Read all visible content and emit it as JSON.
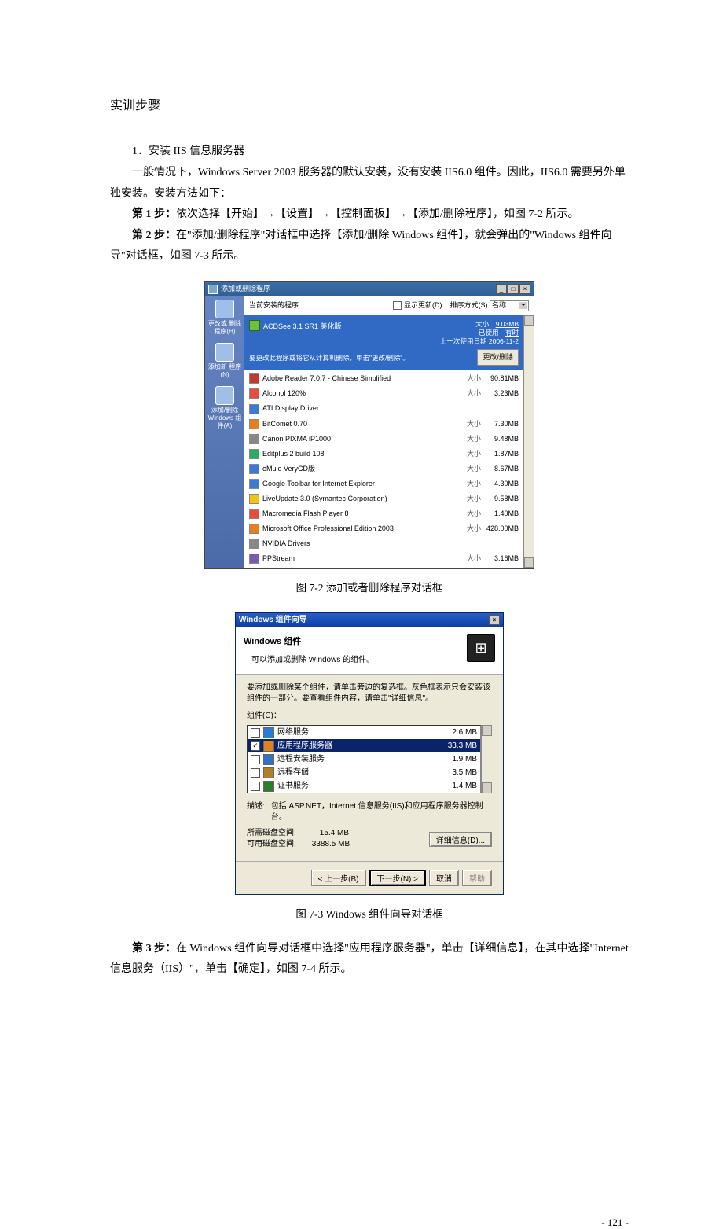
{
  "doc": {
    "heading": "实训步骤",
    "sub1_num": "1．",
    "sub1_title": "安装 IIS 信息服务器",
    "para1": "一般情况下，Windows Server 2003 服务器的默认安装，没有安装 IIS6.0 组件。因此，IIS6.0 需要另外单独安装。安装方法如下：",
    "step1_b": "第 1 步：",
    "step1_t": "依次选择【开始】→【设置】→【控制面板】→【添加/删除程序】，如图 7-2 所示。",
    "step2_b": "第 2 步：",
    "step2_t": "在\"添加/删除程序\"对话框中选择【添加/删除 Windows 组件】，就会弹出的\"Windows 组件向导\"对话框，如图 7-3 所示。",
    "cap1": "图 7-2   添加或者删除程序对话框",
    "cap2": "图 7-3   Windows 组件向导对话框",
    "step3_b": "第 3 步：",
    "step3_t": "在 Windows 组件向导对话框中选择\"应用程序服务器\"，单击【详细信息】，在其中选择\"Internet 信息服务（IIS）\"，单击【确定】，如图 7-4 所示。",
    "pagenum": "- 121 -"
  },
  "ar": {
    "title": "添加或删除程序",
    "side": [
      "更改或\n删除\n程序(H)",
      "添加新\n程序(N)",
      "添加/删除\nWindows\n组件(A)"
    ],
    "top_lbl": "当前安装的程序:",
    "top_show": "显示更新(D)",
    "top_sort": "排序方式(S):",
    "top_sort_val": "名称",
    "sel_name": "ACDSee 3.1 SR1 美化版",
    "sel_meta": [
      {
        "k": "大小",
        "v": "9.03MB"
      },
      {
        "k": "已使用",
        "v": "有时"
      },
      {
        "k": "上一次使用日期",
        "v": "2006-11-2"
      }
    ],
    "sel_info": "要更改此程序或将它从计算机删除，单击\"更改/删除\"。",
    "sel_btn": "更改/删除",
    "rows": [
      {
        "n": "Adobe Reader 7.0.7 - Chinese Simplified",
        "s": "90.81MB",
        "ic": "ry"
      },
      {
        "n": "Alcohol 120%",
        "s": "3.23MB",
        "ic": "rd"
      },
      {
        "n": "ATI Display Driver",
        "s": "",
        "ic": "bl"
      },
      {
        "n": "BitComet 0.70",
        "s": "7.30MB",
        "ic": "or"
      },
      {
        "n": "Canon PIXMA iP1000",
        "s": "9.48MB",
        "ic": "gr"
      },
      {
        "n": "Editplus 2 build 108",
        "s": "1.87MB",
        "ic": "gn"
      },
      {
        "n": "eMule VeryCD版",
        "s": "8.67MB",
        "ic": "bl"
      },
      {
        "n": "Google Toolbar for Internet Explorer",
        "s": "4.30MB",
        "ic": "bl"
      },
      {
        "n": "LiveUpdate 3.0 (Symantec Corporation)",
        "s": "9.58MB",
        "ic": "yl"
      },
      {
        "n": "Macromedia Flash Player 8",
        "s": "1.40MB",
        "ic": "rd"
      },
      {
        "n": "Microsoft Office Professional Edition 2003",
        "s": "428.00MB",
        "ic": "or"
      },
      {
        "n": "NVIDIA Drivers",
        "s": "",
        "ic": "gr"
      },
      {
        "n": "PPStream",
        "s": "3.16MB",
        "ic": "pu"
      }
    ],
    "row_lbl": "大小"
  },
  "wz": {
    "title": "Windows 组件向导",
    "hd_title": "Windows 组件",
    "hd_sub": "可以添加或删除 Windows 的组件。",
    "instr": "要添加或删除某个组件，请单击旁边的复选框。灰色框表示只会安装该组件的一部分。要查看组件内容，请单击\"详细信息\"。",
    "list_lbl": "组件(C)：",
    "items": [
      {
        "n": "网络服务",
        "s": "2.6 MB",
        "chk": false,
        "ic": "#2a7bd5"
      },
      {
        "n": "应用程序服务器",
        "s": "33.3 MB",
        "chk": true,
        "sel": true,
        "ic": "#e67e22"
      },
      {
        "n": "远程安装服务",
        "s": "1.9 MB",
        "chk": false,
        "ic": "#3171c5"
      },
      {
        "n": "远程存储",
        "s": "3.5 MB",
        "chk": false,
        "ic": "#b07d2a"
      },
      {
        "n": "证书服务",
        "s": "1.4 MB",
        "chk": false,
        "ic": "#2a7f2a"
      }
    ],
    "desc_lbl": "描述:",
    "desc_txt": "包括 ASP.NET，Internet 信息服务(IIS)和应用程序服务器控制台。",
    "req_lbl": "所需磁盘空间:",
    "req_val": "15.4 MB",
    "avail_lbl": "可用磁盘空间:",
    "avail_val": "3388.5 MB",
    "detail_btn": "详细信息(D)...",
    "back": "< 上一步(B)",
    "next": "下一步(N) >",
    "cancel": "取消",
    "help": "帮助"
  }
}
